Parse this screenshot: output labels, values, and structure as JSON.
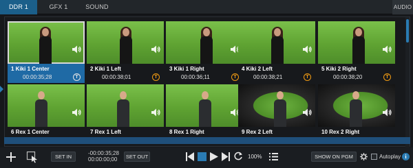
{
  "tabs": [
    {
      "label": "DDR 1",
      "active": true
    },
    {
      "label": "GFX 1",
      "active": false
    },
    {
      "label": "SOUND",
      "active": false
    }
  ],
  "audio_tab": {
    "label": "AUDIO"
  },
  "clips": [
    {
      "name": "1 Kiki 1 Center",
      "duration": "00:00:35;28",
      "badge": "T",
      "selected": true,
      "subject": "female"
    },
    {
      "name": "2 Kiki 1 Left",
      "duration": "00:00:38;01",
      "badge": "T",
      "selected": false,
      "subject": "female"
    },
    {
      "name": "3 Kiki 1 Right",
      "duration": "00:00:36;11",
      "badge": "T",
      "selected": false,
      "subject": "female"
    },
    {
      "name": "4 Kiki 2 Left",
      "duration": "00:00:38;21",
      "badge": "T",
      "selected": false,
      "subject": "female"
    },
    {
      "name": "5 Kiki 2 Right",
      "duration": "00:00:38;20",
      "badge": "T",
      "selected": false,
      "subject": "female"
    },
    {
      "name": "6 Rex 1 Center",
      "duration": "",
      "badge": "",
      "selected": false,
      "subject": "male"
    },
    {
      "name": "7 Rex 1 Left",
      "duration": "",
      "badge": "",
      "selected": false,
      "subject": "male"
    },
    {
      "name": "8 Rex 1 Right",
      "duration": "",
      "badge": "",
      "selected": false,
      "subject": "male"
    },
    {
      "name": "9 Rex 2 Left",
      "duration": "",
      "badge": "",
      "selected": false,
      "subject": "male"
    },
    {
      "name": "10 Rex 2 Right",
      "duration": "",
      "badge": "",
      "selected": false,
      "subject": "male"
    }
  ],
  "playback_progress": 0.0,
  "toolbar": {
    "set_in_label": "SET IN",
    "set_out_label": "SET OUT",
    "timecode_remaining": "-00:00:35;28",
    "timecode_elapsed": "00:00:00;00",
    "zoom": "100%",
    "show_on_pgm_label": "SHOW ON PGM",
    "autoplay_label": "Autoplay",
    "autoplay_checked": false
  },
  "icons": {
    "add": "plus-icon",
    "select": "select-arrow-icon",
    "prev": "skip-back-icon",
    "stop": "stop-icon",
    "play": "play-icon",
    "next": "skip-forward-icon",
    "loop": "loop-icon",
    "playlist": "playlist-icon",
    "settings": "gear-icon",
    "info": "info-icon",
    "speaker": "speaker-icon"
  },
  "colors": {
    "accent": "#1f6aa5",
    "badge_orange": "#f39c12",
    "stop_blue": "#2a7bb3"
  }
}
